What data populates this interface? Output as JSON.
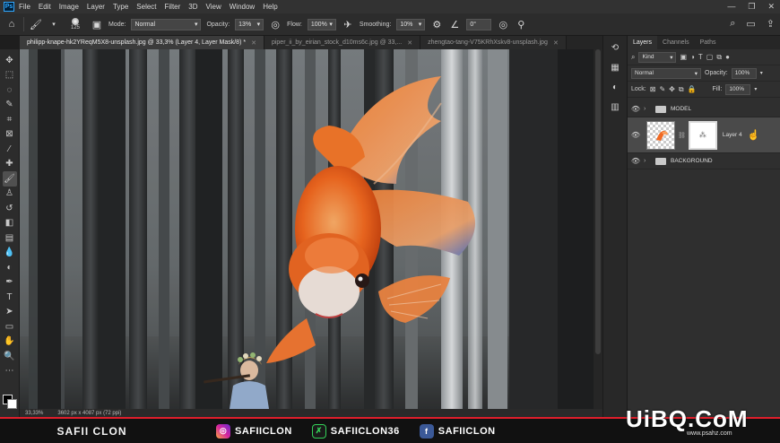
{
  "app": {
    "logo": "Ps"
  },
  "menu": [
    "File",
    "Edit",
    "Image",
    "Layer",
    "Type",
    "Select",
    "Filter",
    "3D",
    "View",
    "Window",
    "Help"
  ],
  "options": {
    "brush_size": "125",
    "mode_label": "Mode:",
    "mode_value": "Normal",
    "opacity_label": "Opacity:",
    "opacity_value": "13%",
    "flow_label": "Flow:",
    "flow_value": "100%",
    "smoothing_label": "Smoothing:",
    "smoothing_value": "10%",
    "angle_value": "0°"
  },
  "tabs": [
    {
      "label": "philipp-knape-hk2YReqM5X8-unsplash.jpg @ 33,3% (Layer 4, Layer Mask/8) *",
      "active": true
    },
    {
      "label": "piper_ii_by_eirian_stock_d10ms6c.jpg @ 33,...",
      "active": false
    },
    {
      "label": "zhengtao-tang-V75KRhXskv8-unsplash.jpg",
      "active": false
    }
  ],
  "status": {
    "zoom": "33,33%",
    "doc_info": "3602 px x 4087 px (72 ppi)"
  },
  "layers_panel": {
    "tabs": [
      "Layers",
      "Channels",
      "Paths"
    ],
    "kind_value": "Kind",
    "blend_value": "Normal",
    "opacity_label": "Opacity:",
    "opacity_value": "100%",
    "lock_label": "Lock:",
    "fill_label": "Fill:",
    "fill_value": "100%",
    "layers": [
      {
        "name": "MODEL",
        "type": "group"
      },
      {
        "name": "Layer 4",
        "type": "layer",
        "selected": true
      },
      {
        "name": "BACKGROUND",
        "type": "group"
      }
    ]
  },
  "banner": {
    "name": "SAFII CLON",
    "instagram": "SAFIICLON",
    "gaming": "SAFIICLON36",
    "facebook": "SAFIICLON"
  },
  "watermark": {
    "text": "UiBQ.CoM",
    "sub": "www.psahz.com"
  },
  "colors": {
    "accent": "#31a8ff",
    "banner_red": "#e01e2b",
    "panel": "#2f2f2f"
  }
}
